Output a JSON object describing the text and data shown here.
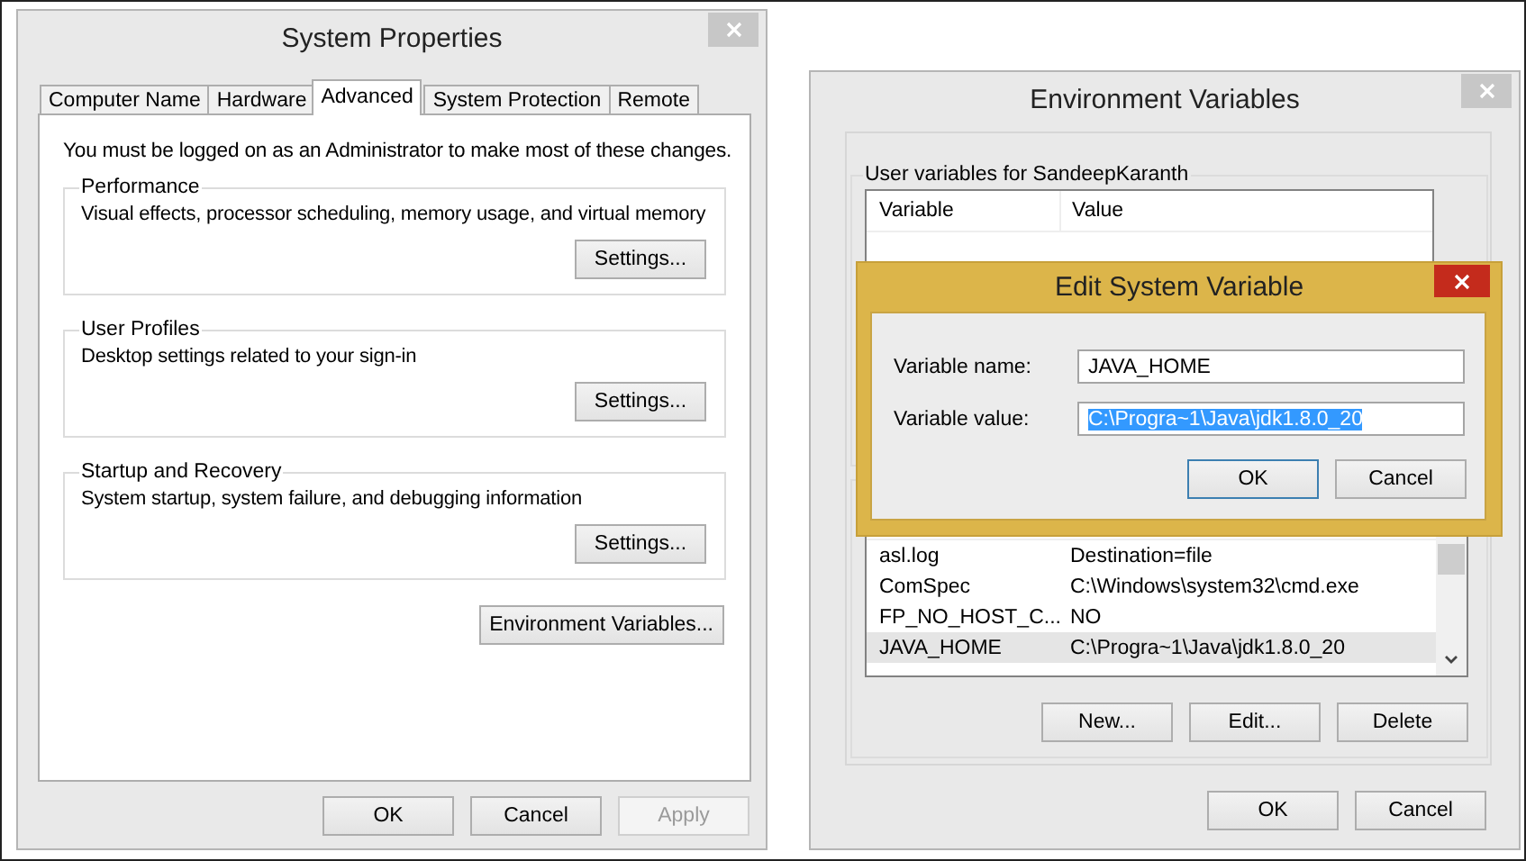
{
  "system_properties": {
    "title": "System Properties",
    "tabs": [
      {
        "label": "Computer Name",
        "selected": false
      },
      {
        "label": "Hardware",
        "selected": false
      },
      {
        "label": "Advanced",
        "selected": true
      },
      {
        "label": "System Protection",
        "selected": false
      },
      {
        "label": "Remote",
        "selected": false
      }
    ],
    "notice": "You must be logged on as an Administrator to make most of these changes.",
    "groups": [
      {
        "title": "Performance",
        "description": "Visual effects, processor scheduling, memory usage, and virtual memory",
        "button": "Settings..."
      },
      {
        "title": "User Profiles",
        "description": "Desktop settings related to your sign-in",
        "button": "Settings..."
      },
      {
        "title": "Startup and Recovery",
        "description": "System startup, system failure, and debugging information",
        "button": "Settings..."
      }
    ],
    "env_button": "Environment Variables...",
    "buttons": [
      {
        "label": "OK",
        "disabled": false
      },
      {
        "label": "Cancel",
        "disabled": false
      },
      {
        "label": "Apply",
        "disabled": true
      }
    ]
  },
  "environment_variables": {
    "title": "Environment Variables",
    "user_group": {
      "title": "User variables for SandeepKaranth",
      "columns": [
        "Variable",
        "Value"
      ]
    },
    "system_rows": [
      {
        "variable": "asl.log",
        "value": "Destination=file",
        "selected": false
      },
      {
        "variable": "ComSpec",
        "value": "C:\\Windows\\system32\\cmd.exe",
        "selected": false
      },
      {
        "variable": "FP_NO_HOST_C...",
        "value": "NO",
        "selected": false
      },
      {
        "variable": "JAVA_HOME",
        "value": "C:\\Progra~1\\Java\\jdk1.8.0_20",
        "selected": true
      }
    ],
    "row_buttons": [
      "New...",
      "Edit...",
      "Delete"
    ],
    "buttons": [
      "OK",
      "Cancel"
    ]
  },
  "edit_dialog": {
    "title": "Edit System Variable",
    "fields": [
      {
        "label": "Variable name:",
        "value": "JAVA_HOME",
        "text_selected": false
      },
      {
        "label": "Variable value:",
        "value": "C:\\Progra~1\\Java\\jdk1.8.0_20",
        "text_selected": true
      }
    ],
    "buttons": [
      {
        "label": "OK",
        "default": true
      },
      {
        "label": "Cancel",
        "default": false
      }
    ]
  }
}
